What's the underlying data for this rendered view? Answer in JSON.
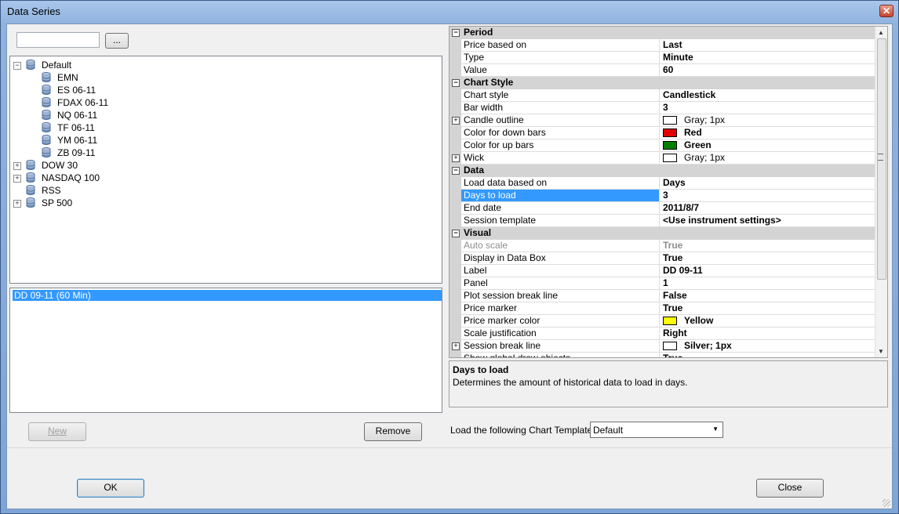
{
  "window": {
    "title": "Data Series",
    "close_glyph": "✕"
  },
  "top": {
    "browse_label": "..."
  },
  "tree": [
    {
      "label": "Default",
      "expanded": true,
      "children": [
        "EMN",
        "ES 06-11",
        "FDAX 06-11",
        "NQ 06-11",
        "TF 06-11",
        "YM 06-11",
        "ZB 09-11"
      ]
    },
    {
      "label": "DOW 30",
      "expanded": false
    },
    {
      "label": "NASDAQ 100",
      "expanded": false
    },
    {
      "label": "RSS",
      "expanded": null
    },
    {
      "label": "SP 500",
      "expanded": false
    }
  ],
  "series_list": {
    "selected": "DD 09-11 (60 Min)"
  },
  "left_buttons": {
    "new_label": "New",
    "remove_label": "Remove"
  },
  "properties": [
    {
      "type": "cat",
      "name": "Period"
    },
    {
      "name": "Price based on",
      "value": "Last"
    },
    {
      "name": "Type",
      "value": "Minute"
    },
    {
      "name": "Value",
      "value": "60"
    },
    {
      "type": "cat",
      "name": "Chart Style"
    },
    {
      "name": "Chart style",
      "value": "Candlestick"
    },
    {
      "name": "Bar width",
      "value": "3"
    },
    {
      "name": "Candle outline",
      "value": "Gray; 1px",
      "expand": true,
      "swatch": "#ffffff",
      "light": true
    },
    {
      "name": "Color for down bars",
      "value": "Red",
      "swatch": "#e00000"
    },
    {
      "name": "Color for up bars",
      "value": "Green",
      "swatch": "#008000"
    },
    {
      "name": "Wick",
      "value": "Gray; 1px",
      "expand": true,
      "swatch": "#ffffff",
      "light": true
    },
    {
      "type": "cat",
      "name": "Data"
    },
    {
      "name": "Load data based on",
      "value": "Days"
    },
    {
      "name": "Days to load",
      "value": "3",
      "selected": true
    },
    {
      "name": "End date",
      "value": "2011/8/7"
    },
    {
      "name": "Session template",
      "value": "<Use instrument settings>"
    },
    {
      "type": "cat",
      "name": "Visual"
    },
    {
      "name": "Auto scale",
      "value": "True",
      "disabled": true
    },
    {
      "name": "Display in Data Box",
      "value": "True"
    },
    {
      "name": "Label",
      "value": "DD 09-11"
    },
    {
      "name": "Panel",
      "value": "1"
    },
    {
      "name": "Plot session break line",
      "value": "False"
    },
    {
      "name": "Price marker",
      "value": "True"
    },
    {
      "name": "Price marker color",
      "value": "Yellow",
      "swatch": "#ffff00"
    },
    {
      "name": "Scale justification",
      "value": "Right"
    },
    {
      "name": "Session break line",
      "value": "Silver; 1px",
      "expand": true,
      "swatch": "#ffffff"
    },
    {
      "name": "Show global draw objects",
      "value": "True"
    }
  ],
  "description": {
    "title": "Days to load",
    "text": "Determines the amount of historical data to load in days."
  },
  "template": {
    "label": "Load the following Chart Template:",
    "value": "Default"
  },
  "footer": {
    "ok_label": "OK",
    "close_label": "Close"
  }
}
